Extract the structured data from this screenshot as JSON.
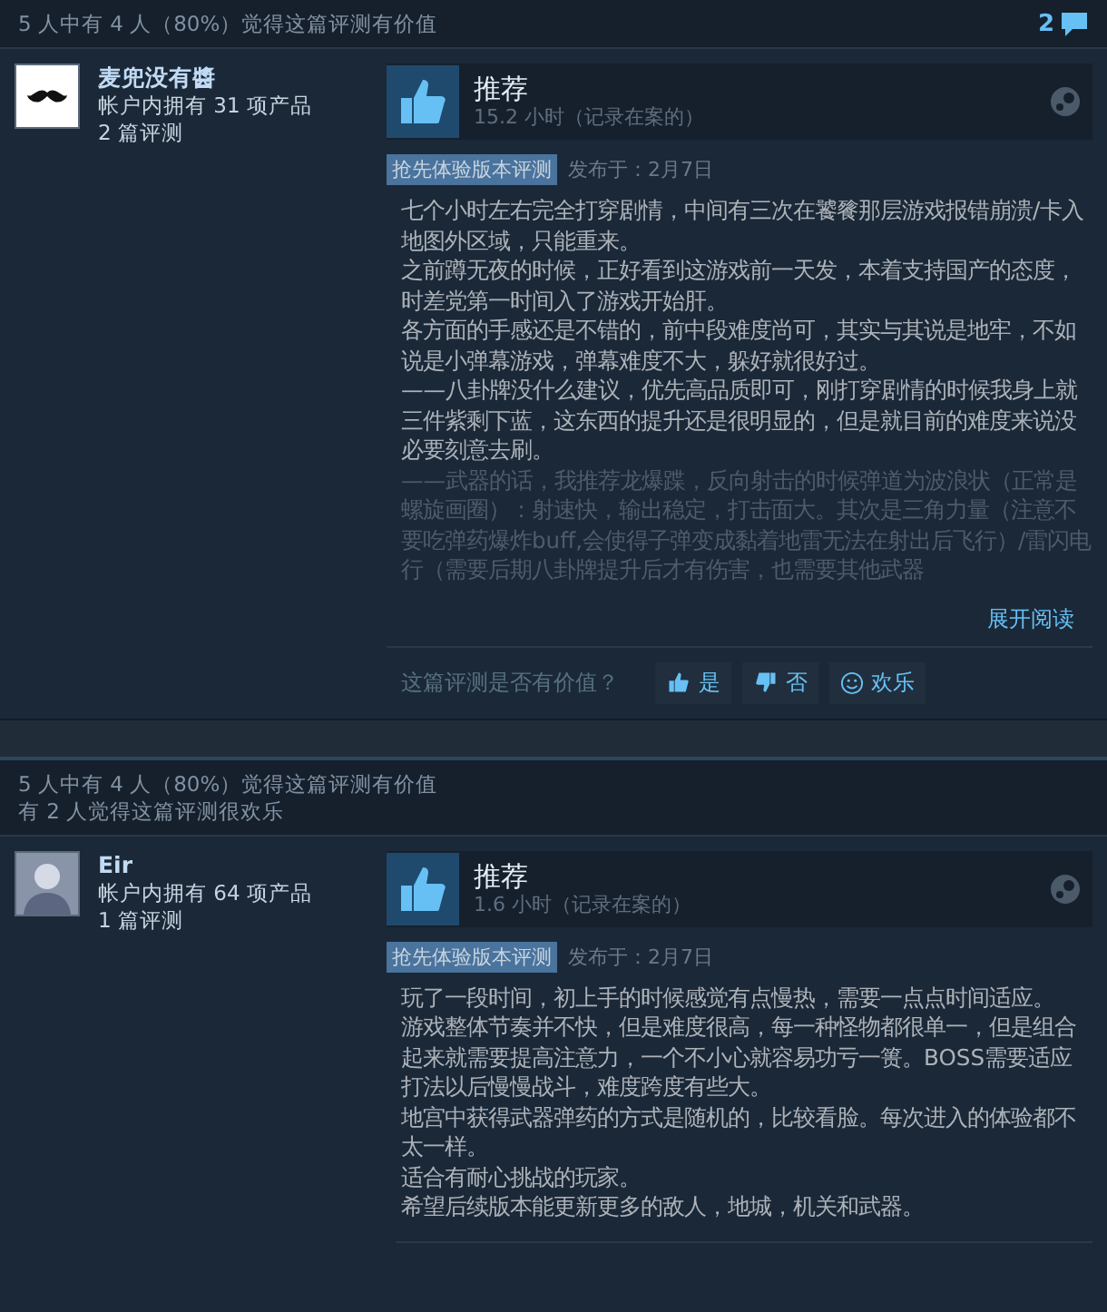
{
  "reviews": [
    {
      "helpful_lines": [
        "5 人中有 4 人（80%）觉得这篇评测有价值"
      ],
      "comment_count": "2",
      "author": {
        "name": "麦兜没有醬",
        "products": "帐户内拥有 31 项产品",
        "reviews": "2 篇评测",
        "avatar": {
          "kind": "mustache"
        }
      },
      "verdict": "推荐",
      "hours": "15.2 小时（记录在案的）",
      "badge": "抢先体验版本评测",
      "posted": "发布于：2月7日",
      "body": [
        "七个小时左右完全打穿剧情，中间有三次在饕餮那层游戏报错崩溃/卡入地图外区域，只能重来。",
        "之前蹲无夜的时候，正好看到这游戏前一天发，本着支持国产的态度，时差党第一时间入了游戏开始肝。",
        "各方面的手感还是不错的，前中段难度尚可，其实与其说是地牢，不如说是小弹幕游戏，弹幕难度不大，躲好就很好过。",
        "——八卦牌没什么建议，优先高品质即可，刚打穿剧情的时候我身上就三件紫剩下蓝，这东西的提升还是很明显的，但是就目前的难度来说没必要刻意去刷。",
        "——武器的话，我推荐龙爆蹀，反向射击的时候弹道为波浪状（正常是螺旋画圈）：射速快，输出稳定，打击面大。其次是三角力量（注意不要吃弹药爆炸buff,会使得子弹变成黏着地雷无法在射出后飞行）/雷闪电行（需要后期八卦牌提升后才有伤害，也需要其他武器"
      ],
      "truncated": true,
      "expand": "展开阅读",
      "vote_prompt": "这篇评测是否有价值？",
      "vote_buttons": [
        {
          "kind": "up",
          "label": "是"
        },
        {
          "kind": "down",
          "label": "否"
        },
        {
          "kind": "funny",
          "label": "欢乐"
        }
      ]
    },
    {
      "helpful_lines": [
        "5 人中有 4 人（80%）觉得这篇评测有价值",
        "有 2 人觉得这篇评测很欢乐"
      ],
      "author": {
        "name": "Eir",
        "products": "帐户内拥有 64 项产品",
        "reviews": "1 篇评测",
        "avatar": {
          "kind": "silhouette"
        }
      },
      "verdict": "推荐",
      "hours": "1.6 小时（记录在案的）",
      "badge": "抢先体验版本评测",
      "posted": "发布于：2月7日",
      "body": [
        "玩了一段时间，初上手的时候感觉有点慢热，需要一点点时间适应。",
        "游戏整体节奏并不快，但是难度很高，每一种怪物都很单一，但是组合起来就需要提高注意力，一个不小心就容易功亏一篑。BOSS需要适应打法以后慢慢战斗，难度跨度有些大。",
        "地宫中获得武器弹药的方式是随机的，比较看脸。每次进入的体验都不太一样。",
        "适合有耐心挑战的玩家。",
        "希望后续版本能更新更多的敌人，地城，机关和武器。"
      ],
      "truncated": false
    }
  ]
}
